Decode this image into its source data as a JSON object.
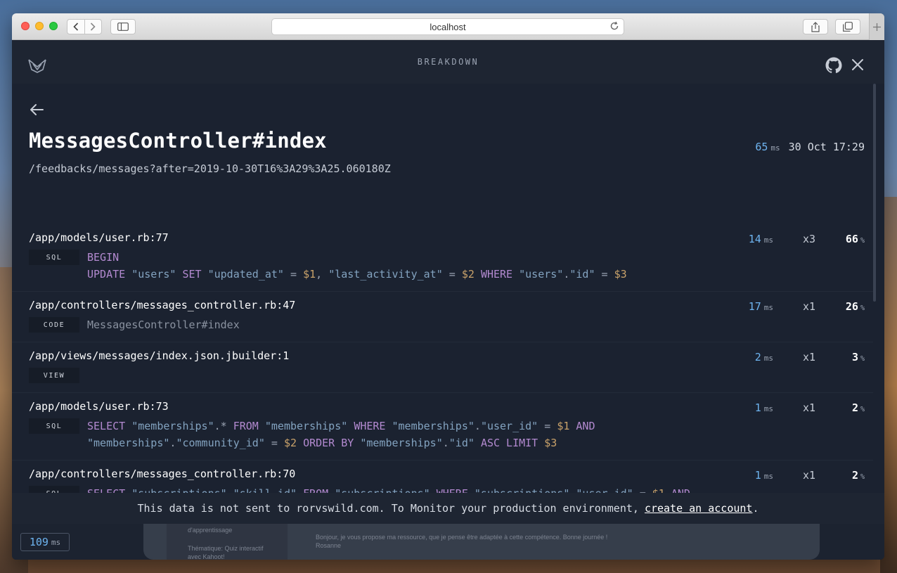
{
  "browser": {
    "address": "localhost"
  },
  "app": {
    "header_title": "BREAKDOWN",
    "title": "MessagesController#index",
    "path": "/feedbacks/messages?after=2019-10-30T16%3A29%3A25.060180Z",
    "duration": "65",
    "duration_unit": "ms",
    "date": "30 Oct 17:29"
  },
  "sections": [
    {
      "file": "/app/models/user.rb:77",
      "ms": "14",
      "ms_unit": "ms",
      "count": "x3",
      "pct": "66",
      "pct_unit": "%",
      "kind": "SQL",
      "lines": [
        "BEGIN",
        "UPDATE \"users\" SET \"updated_at\" = $1, \"last_activity_at\" = $2 WHERE \"users\".\"id\" = $3"
      ]
    },
    {
      "file": "/app/controllers/messages_controller.rb:47",
      "ms": "17",
      "ms_unit": "ms",
      "count": "x1",
      "pct": "26",
      "pct_unit": "%",
      "kind": "CODE",
      "lines": [
        "MessagesController#index"
      ]
    },
    {
      "file": "/app/views/messages/index.json.jbuilder:1",
      "ms": "2",
      "ms_unit": "ms",
      "count": "x1",
      "pct": "3",
      "pct_unit": "%",
      "kind": "VIEW",
      "lines": []
    },
    {
      "file": "/app/models/user.rb:73",
      "ms": "1",
      "ms_unit": "ms",
      "count": "x1",
      "pct": "2",
      "pct_unit": "%",
      "kind": "SQL",
      "lines": [
        "SELECT \"memberships\".* FROM \"memberships\" WHERE \"memberships\".\"user_id\" = $1 AND",
        "\"memberships\".\"community_id\" = $2 ORDER BY \"memberships\".\"id\" ASC LIMIT $3"
      ]
    },
    {
      "file": "/app/controllers/messages_controller.rb:70",
      "ms": "1",
      "ms_unit": "ms",
      "count": "x1",
      "pct": "2",
      "pct_unit": "%",
      "kind": "SQL",
      "lines": [
        "SELECT \"subscriptions\".\"skill_id\" FROM \"subscriptions\" WHERE \"subscriptions\".\"user_id\" = $1 AND"
      ]
    }
  ],
  "footer": {
    "text": "This data is not sent to rorvswild.com. To Monitor your production environment,",
    "link": "create an account",
    "tail": "."
  },
  "toolbar_pill": {
    "value": "109",
    "unit": "ms"
  },
  "underlying_page": {
    "sidebar_line1": "d'apprentissage",
    "sidebar_line2": "Thématique: Quiz interactif",
    "sidebar_line3": "avec Kahoot!",
    "message_line1": "Bonjour, je vous propose ma ressource, que je pense être adaptée à cette compétence. Bonne journée !",
    "message_line2": "Rosanne"
  },
  "colors": {
    "accent_ms": "#6eb4f0",
    "sql_keyword": "#b38ad0",
    "sql_string": "#83a3c0",
    "sql_param": "#c9a26a",
    "background": "#1b2230"
  }
}
